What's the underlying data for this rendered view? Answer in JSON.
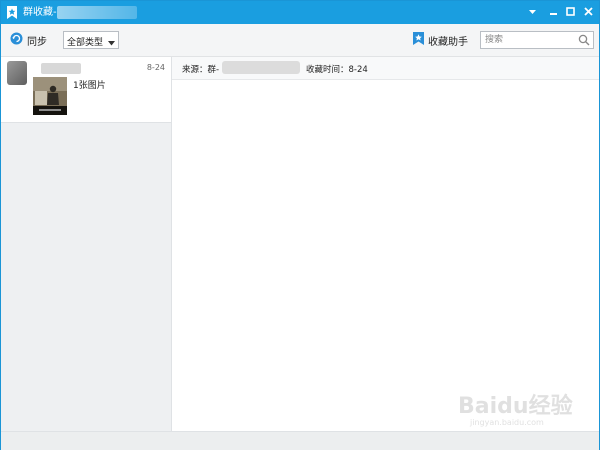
{
  "window": {
    "title": "群收藏-",
    "accent_color": "#1a9ee0",
    "controls": [
      "chevron-down-icon",
      "minimize-icon",
      "maximize-icon",
      "close-icon"
    ]
  },
  "toolbar": {
    "sync_label": "同步",
    "type_filter": {
      "selected": "全部类型"
    },
    "assistant_label": "收藏助手",
    "search": {
      "placeholder": "搜索",
      "value": ""
    }
  },
  "list": {
    "items": [
      {
        "date": "8-24",
        "description": "1张图片"
      }
    ]
  },
  "detail": {
    "source_label": "来源：群-",
    "time_label": "收藏时间：8-24"
  },
  "watermark": {
    "text": "Baidu经验",
    "subtext": "jingyan.baidu.com"
  }
}
